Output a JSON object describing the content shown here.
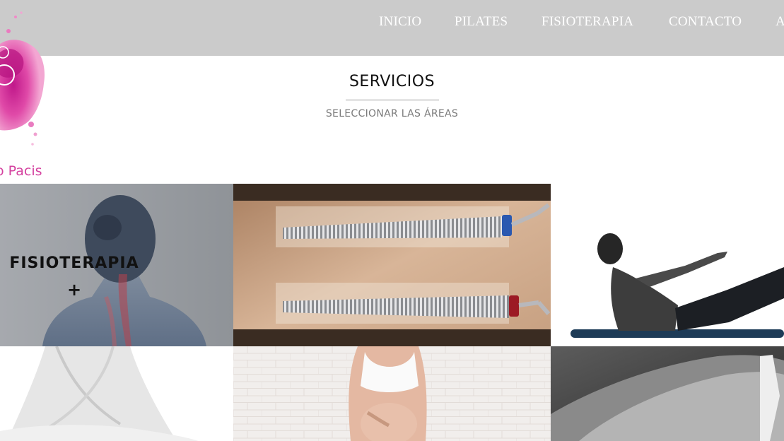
{
  "nav": {
    "items": [
      {
        "label": "INICIO"
      },
      {
        "label": "PILATES"
      },
      {
        "label": "FISIOTERAPIA"
      },
      {
        "label": "CONTACTO"
      },
      {
        "label": "A"
      }
    ]
  },
  "section": {
    "title": "SERVICIOS",
    "subtitle": "SELECCIONAR LAS ÁREAS"
  },
  "brand": {
    "partial_name": "o Pacis"
  },
  "tiles": [
    {
      "label": "FISIOTERAPIA",
      "plus": "+"
    }
  ],
  "colors": {
    "header_bg": "#cbcbcb",
    "nav_text": "#ffffff",
    "brand_pink": "#d4419f",
    "title_text": "#111111",
    "subtitle_text": "#7a7a7a"
  }
}
